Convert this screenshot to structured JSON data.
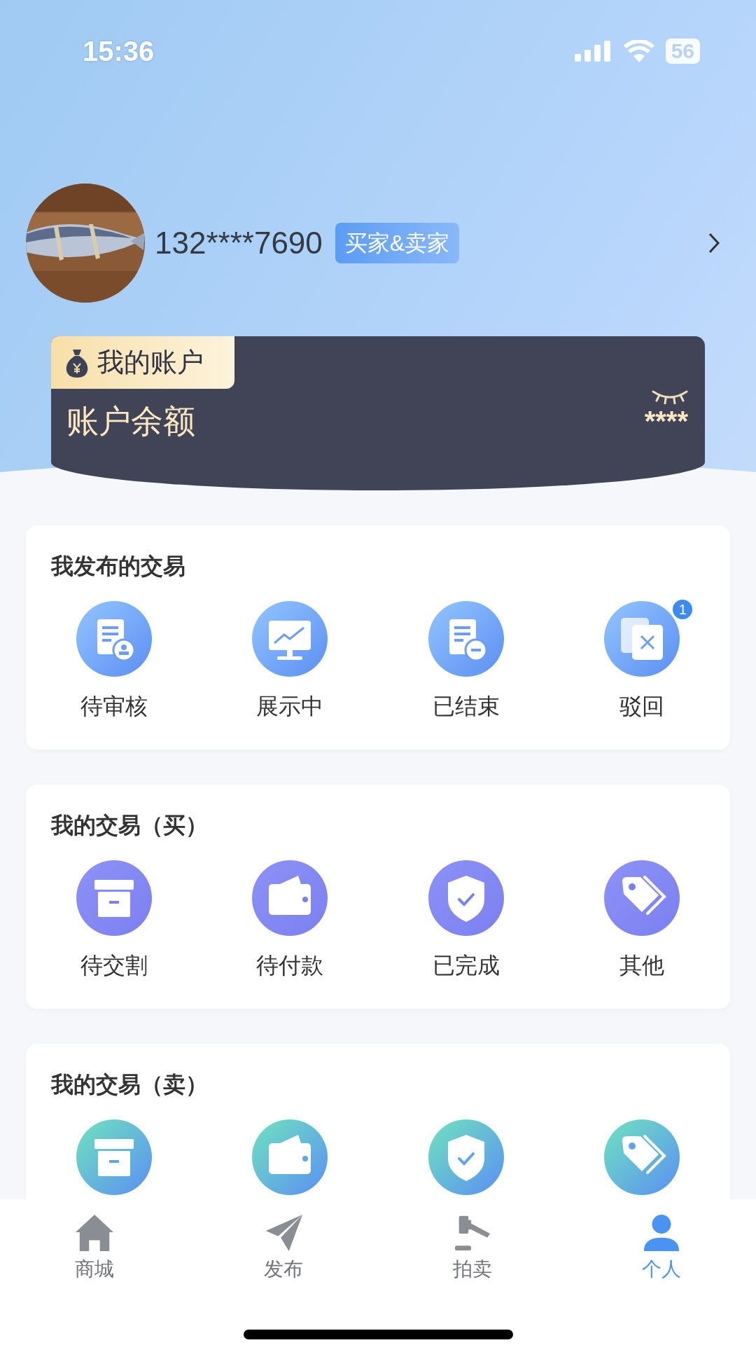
{
  "status_bar": {
    "time": "15:36",
    "battery": "56"
  },
  "profile": {
    "phone": "132****7690",
    "role": "买家&卖家"
  },
  "account": {
    "tag": "我的账户",
    "label": "账户余额",
    "balance": "****",
    "hidden": true
  },
  "sections": [
    {
      "kind": "publish",
      "title": "我发布的交易",
      "items": [
        {
          "kind": "doc-stamp",
          "label": "待审核"
        },
        {
          "kind": "monitor",
          "label": "展示中"
        },
        {
          "kind": "doc-minus",
          "label": "已结束"
        },
        {
          "kind": "copy-x",
          "label": "驳回",
          "badge": "1"
        }
      ]
    },
    {
      "kind": "buy",
      "title": "我的交易（买）",
      "items": [
        {
          "kind": "box",
          "label": "待交割"
        },
        {
          "kind": "wallet",
          "label": "待付款"
        },
        {
          "kind": "shield",
          "label": "已完成"
        },
        {
          "kind": "tag",
          "label": "其他"
        }
      ]
    },
    {
      "kind": "sell",
      "title": "我的交易（卖）",
      "items": [
        {
          "kind": "box"
        },
        {
          "kind": "wallet"
        },
        {
          "kind": "shield"
        },
        {
          "kind": "tag"
        }
      ]
    }
  ],
  "tabs": [
    {
      "kind": "home",
      "label": "商城",
      "selected": false
    },
    {
      "kind": "plane",
      "label": "发布",
      "selected": false
    },
    {
      "kind": "gavel",
      "label": "拍卖",
      "selected": false
    },
    {
      "kind": "person",
      "label": "个人",
      "selected": true
    }
  ]
}
